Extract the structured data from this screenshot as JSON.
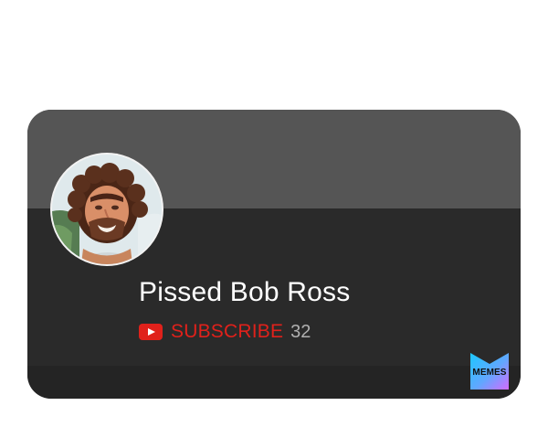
{
  "channel": {
    "name": "Pissed Bob Ross",
    "avatar_icon": "bob-ross-portrait-avatar",
    "subscribe_label": "SUBSCRIBE",
    "subscriber_count": "32",
    "subscribe_icon": "youtube-play-icon"
  },
  "colors": {
    "banner": "#555555",
    "card_body": "#2a2a2a",
    "subscribe_red": "#e0211b",
    "count_gray": "#b0b0b0",
    "name_white": "#ffffff"
  },
  "watermark": {
    "text": "MEMES",
    "icon": "memes-logo"
  }
}
